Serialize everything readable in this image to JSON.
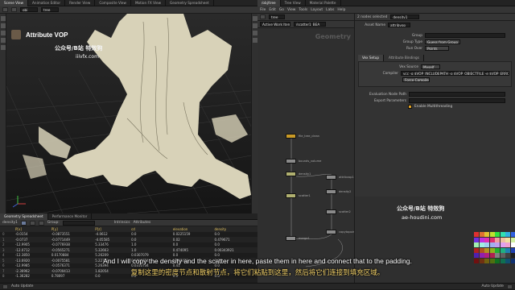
{
  "left_tabs": [
    "Scene View",
    "Animation Editor",
    "Render View",
    "Composite View",
    "Motion FX View",
    "Geometry Spreadsheet"
  ],
  "right_top_tabs": [
    "/obj/tree",
    "Tree View",
    "Material Palette"
  ],
  "viewport": {
    "path": "obj",
    "geo": "tree",
    "title": "Attribute VOP",
    "watermark_line1": "公众号/B站 特效狗",
    "watermark_line2": "iiivfx.com"
  },
  "network": {
    "menu": [
      "File",
      "Edit",
      "Go",
      "View",
      "Tools",
      "Layout",
      "Labs",
      "Help"
    ],
    "path": "tree",
    "path_btn": "Active Work Items",
    "node_path": "/scatter1_BEA",
    "context_label": "Geometry",
    "watermark_line1": "公众号/B站 特效狗",
    "watermark_line2": "ae-houdini.com",
    "nodes": [
      {
        "label": "file_tree_clean",
        "color": "#c99a27"
      },
      {
        "label": "bounds_volume",
        "color": "#8a8a8a"
      },
      {
        "label": "density1",
        "color": "#b0b070"
      },
      {
        "label": "scatter1",
        "color": "#b0b070"
      },
      {
        "label": "attribvop1",
        "color": "#8a8a8a"
      },
      {
        "label": "density2",
        "color": "#8a8a8a"
      },
      {
        "label": "scatter2",
        "color": "#8a8a8a"
      },
      {
        "label": "copytopoints1",
        "color": "#8a8a8a"
      },
      {
        "label": "merge1",
        "color": "#8a8a8a"
      }
    ]
  },
  "params": {
    "header": "2 nodes selected",
    "type_label": "density1",
    "node_name_label": "Asset Name",
    "node_name": "attribvop",
    "rows": [
      {
        "label": "Group",
        "value": ""
      },
      {
        "label": "Group Type",
        "value": "Guess from Group"
      },
      {
        "label": "Run Over",
        "value": "Points"
      }
    ],
    "tabs": [
      "Vex Setup",
      "Attribute Bindings"
    ],
    "vex_source_label": "Vex Source",
    "vex_source": "Myself",
    "compiler_label": "Compiler",
    "compiler": "vcc -q $VOP_INCLUDEPATH -o $VOP_OBJECTFILE -e $VOP_ERRORFILE $VOP_SOURCEFILE",
    "force_compile": "Force Compile",
    "eval_label": "Evaluation Node Path",
    "export_label": "Export Parameters",
    "multithreading": "Enable Multithreading"
  },
  "spreadsheet": {
    "tabs": [
      "Geometry Spreadsheet",
      "Performance Monitor"
    ],
    "node": "density1",
    "group_label": "Group:",
    "intrinsics": "Intrinsics",
    "attributes": "Attributes",
    "columns": [
      "",
      "P[x]",
      "P[y]",
      "P[z]",
      "cd",
      "elevation",
      "density"
    ],
    "rows": [
      [
        "0",
        "-0.0154",
        "-0.0873551",
        "-4.0612",
        "0.0",
        "0.0225159",
        "0.0"
      ],
      [
        "1",
        "-0.0737",
        "-0.0771449",
        "-4.05585",
        "0.0",
        "0.02",
        "0.479671"
      ],
      [
        "2",
        "-12.9905",
        "-0.0776938",
        "5.33476",
        "1.0",
        "0.0",
        "0.0"
      ],
      [
        "3",
        "-12.0712",
        "-0.0565271",
        "5.32663",
        "1.0",
        "0.474095",
        "0.00343921"
      ],
      [
        "4",
        "-12.3850",
        "0.0170884",
        "5.26209",
        "0.0307079",
        "0.0",
        "0.0"
      ],
      [
        "5",
        "-13.6920",
        "-0.0075581",
        "5.22702",
        "0.0310754",
        "0.998433",
        "0.0"
      ],
      [
        "6",
        "-12.9985",
        "-0.0576371",
        "5.26394",
        "0.0310734",
        "0.41",
        "0.0"
      ],
      [
        "7",
        "-2.36962",
        "-0.0700413",
        "1.82054",
        "0.0",
        "0.0",
        "0.0"
      ],
      [
        "8",
        "-1.36282",
        "0.78097",
        "0.0",
        "0.0",
        "0.0",
        "0.0"
      ]
    ]
  },
  "subtitle_en": "And I will copy the density and the scatter in here, paste them in here and connect that to the padding.",
  "subtitle_cn": "复制这里的密度节点和散射节点，将它们粘贴到这里，然后将它们连接到填充区域。",
  "status_left": "Auto Update",
  "status_right": "Auto Update",
  "colors": {
    "accent": "#e0a020",
    "selected_node": "#e0c060",
    "viewport_bg": "#1d1d1d",
    "tree": "#d8d2b8"
  },
  "swatches": [
    "#e03030",
    "#e07030",
    "#e0c030",
    "#c0e030",
    "#30e040",
    "#30e0b0",
    "#30b0e0",
    "#3060e0",
    "#7030e0",
    "#c030e0",
    "#e030b0",
    "#e03070",
    "#f0a0a0",
    "#f0c0a0",
    "#f0e0a0",
    "#d0f0a0",
    "#a0f0b0",
    "#a0f0e0",
    "#a0d0f0",
    "#a0b0f0",
    "#c0a0f0",
    "#e0a0f0",
    "#f0a0d0",
    "#ffffff",
    "#b02020",
    "#b05020",
    "#b09020",
    "#90b020",
    "#20b030",
    "#20b080",
    "#2080b0",
    "#2040b0",
    "#5020b0",
    "#9020b0",
    "#b02080",
    "#b02050",
    "#808080",
    "#606060",
    "#404040",
    "#202020",
    "#701010",
    "#703010",
    "#706010",
    "#507010",
    "#107020",
    "#107050",
    "#105070",
    "#103070"
  ]
}
